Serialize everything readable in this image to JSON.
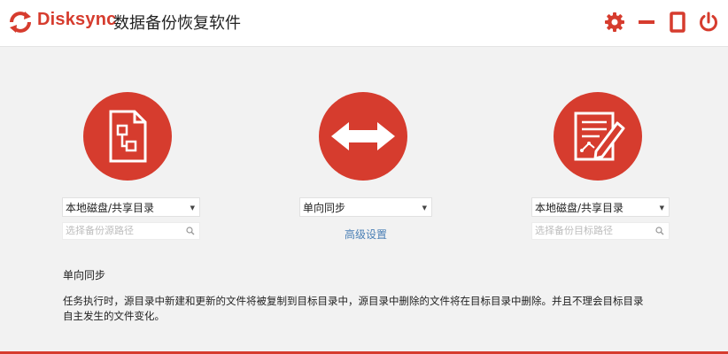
{
  "app": {
    "brand": "Disksync",
    "title": "数据备份恢复软件"
  },
  "window_controls": [
    "gear-icon",
    "minimize-icon",
    "maximize-icon",
    "power-icon"
  ],
  "source": {
    "select_value": "本地磁盘/共享目录",
    "path_placeholder": "选择备份源路径"
  },
  "mode": {
    "select_value": "单向同步",
    "advanced_link": "高级设置"
  },
  "target": {
    "select_value": "本地磁盘/共享目录",
    "path_placeholder": "选择备份目标路径"
  },
  "description": {
    "title": "单向同步",
    "line1": "任务执行时，源目录中新建和更新的文件将被复制到目标目录中，源目录中删除的文件将在目标目录中删除。并且不理会目标目录",
    "line2": "自主发生的文件变化。"
  },
  "colors": {
    "accent": "#d63c2e",
    "link": "#4a7fb5",
    "background": "#f2f2f2"
  }
}
